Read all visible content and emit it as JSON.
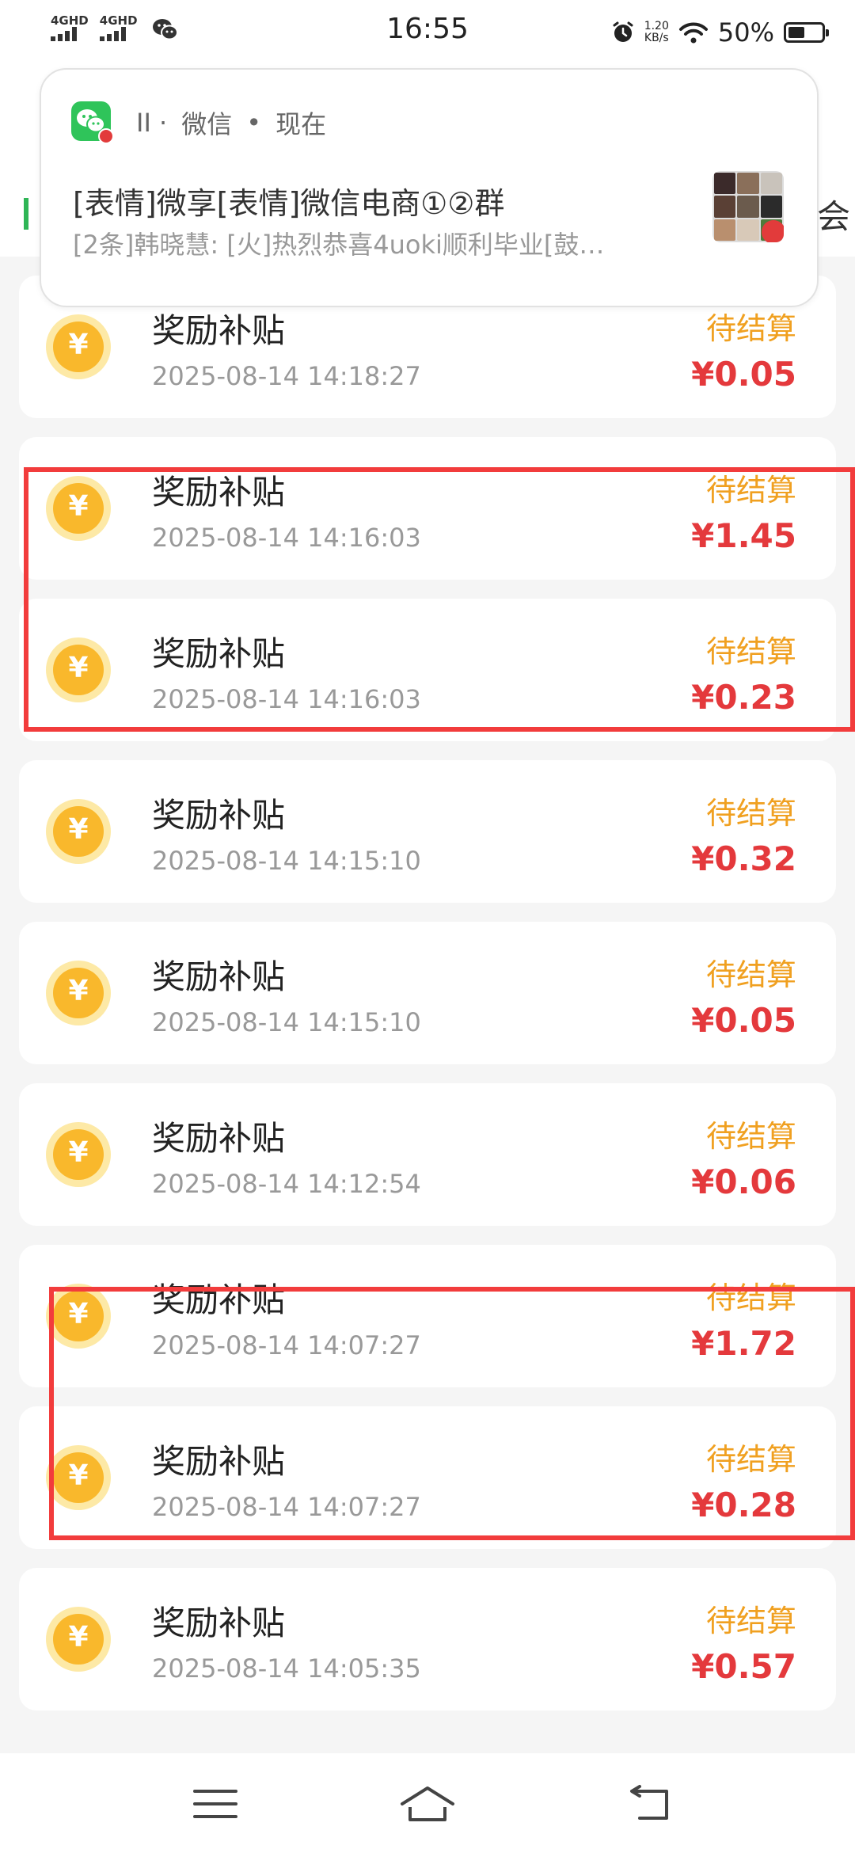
{
  "status_bar": {
    "network_1": "4GHD",
    "network_2": "4GHD",
    "time": "16:55",
    "speed_value": "1.20",
    "speed_unit": "KB/s",
    "battery_percent": "50%",
    "battery_level": 0.5
  },
  "app_header": {
    "right_fragment": "会"
  },
  "notification": {
    "app_name": "微信",
    "head_prefix": "II ·",
    "separator": "•",
    "when": "现在",
    "title": "[表情]微享[表情]微信电商①②群",
    "body": "[2条]韩晓慧: [火]热烈恭喜4uoki顺利毕业[鼓…"
  },
  "records": [
    {
      "title": "奖励补贴",
      "time": "2025-08-14 14:18:27",
      "status": "待结算",
      "amount": "¥0.05"
    },
    {
      "title": "奖励补贴",
      "time": "2025-08-14 14:16:03",
      "status": "待结算",
      "amount": "¥1.45"
    },
    {
      "title": "奖励补贴",
      "time": "2025-08-14 14:16:03",
      "status": "待结算",
      "amount": "¥0.23"
    },
    {
      "title": "奖励补贴",
      "time": "2025-08-14 14:15:10",
      "status": "待结算",
      "amount": "¥0.32"
    },
    {
      "title": "奖励补贴",
      "time": "2025-08-14 14:15:10",
      "status": "待结算",
      "amount": "¥0.05"
    },
    {
      "title": "奖励补贴",
      "time": "2025-08-14 14:12:54",
      "status": "待结算",
      "amount": "¥0.06"
    },
    {
      "title": "奖励补贴",
      "time": "2025-08-14 14:07:27",
      "status": "待结算",
      "amount": "¥1.72"
    },
    {
      "title": "奖励补贴",
      "time": "2025-08-14 14:07:27",
      "status": "待结算",
      "amount": "¥0.28"
    },
    {
      "title": "奖励补贴",
      "time": "2025-08-14 14:05:35",
      "status": "待结算",
      "amount": "¥0.57"
    }
  ],
  "coin_symbol": "¥",
  "colors": {
    "accent_green": "#2fb556",
    "status_orange": "#f0a020",
    "amount_red": "#e4393c",
    "highlight_red": "#f23c3c",
    "coin_gold": "#f9b82c"
  },
  "nav": {
    "menu_icon": "menu-icon",
    "home_icon": "home-icon",
    "back_icon": "back-icon"
  }
}
